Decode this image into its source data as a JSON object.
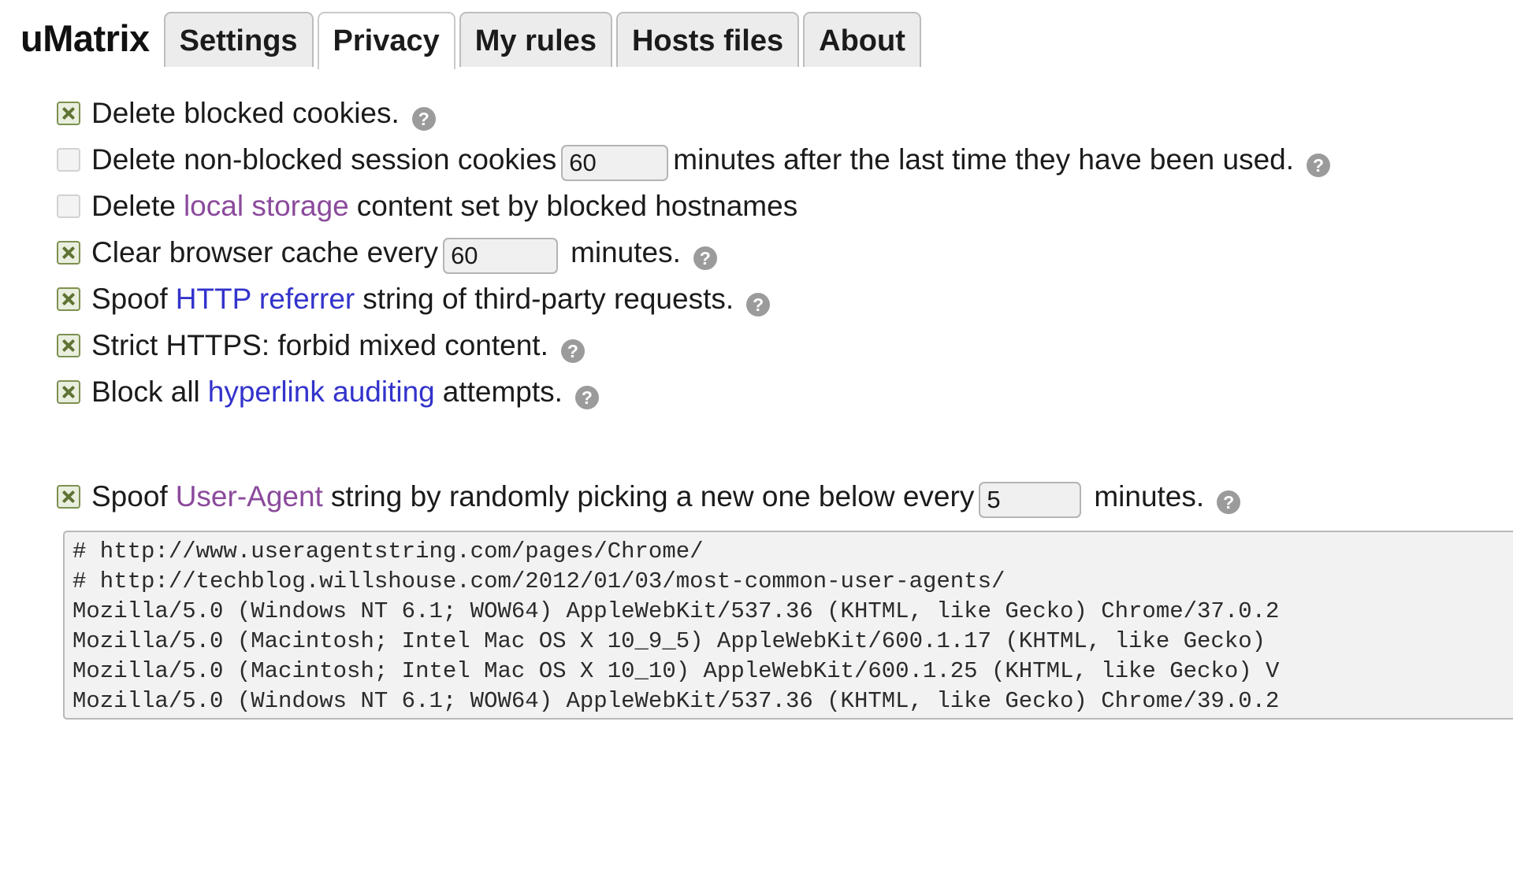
{
  "app": {
    "brand": "uMatrix"
  },
  "tabs": [
    {
      "label": "Settings",
      "active": false
    },
    {
      "label": "Privacy",
      "active": true
    },
    {
      "label": "My rules",
      "active": false
    },
    {
      "label": "Hosts files",
      "active": false
    },
    {
      "label": "About",
      "active": false
    }
  ],
  "icons": {
    "help": "?"
  },
  "colors": {
    "link_unvisited": "#3333cc",
    "link_visited": "#8b4a9c",
    "checkbox_checked_border": "#7d9150",
    "checkbox_checked_mark": "#5f7333",
    "help_icon_bg": "#9b9b9b"
  },
  "privacy": {
    "delete_blocked_cookies": {
      "checked": true,
      "label": "Delete blocked cookies.",
      "help": "?"
    },
    "delete_session_cookies": {
      "checked": false,
      "label_before": "Delete non-blocked session cookies",
      "value": "60",
      "label_after": "minutes after the last time they have been used.",
      "help": "?"
    },
    "delete_local_storage": {
      "checked": false,
      "label_before": "Delete",
      "link": "local storage",
      "label_after": "content set by blocked hostnames"
    },
    "clear_browser_cache": {
      "checked": true,
      "label_before": "Clear browser cache every",
      "value": "60",
      "label_after": "minutes.",
      "help": "?"
    },
    "spoof_referrer": {
      "checked": true,
      "label_before": "Spoof",
      "link": "HTTP referrer",
      "label_after": "string of third-party requests.",
      "help": "?"
    },
    "strict_https": {
      "checked": true,
      "label": "Strict HTTPS: forbid mixed content.",
      "help": "?"
    },
    "block_hyperlink_auditing": {
      "checked": true,
      "label_before": "Block all",
      "link": "hyperlink auditing",
      "label_after": "attempts.",
      "help": "?"
    },
    "spoof_user_agent": {
      "checked": true,
      "label_before": "Spoof",
      "link": "User-Agent",
      "label_mid": "string by randomly picking a new one below every",
      "value": "5",
      "label_after": "minutes.",
      "help": "?"
    },
    "user_agent_strings": [
      "# http://www.useragentstring.com/pages/Chrome/",
      "# http://techblog.willshouse.com/2012/01/03/most-common-user-agents/",
      "Mozilla/5.0 (Windows NT 6.1; WOW64) AppleWebKit/537.36 (KHTML, like Gecko) Chrome/37.0.2",
      "Mozilla/5.0 (Macintosh; Intel Mac OS X 10_9_5) AppleWebKit/600.1.17 (KHTML, like Gecko)",
      "Mozilla/5.0 (Macintosh; Intel Mac OS X 10_10) AppleWebKit/600.1.25 (KHTML, like Gecko) V",
      "Mozilla/5.0 (Windows NT 6.1; WOW64) AppleWebKit/537.36 (KHTML, like Gecko) Chrome/39.0.2"
    ]
  }
}
